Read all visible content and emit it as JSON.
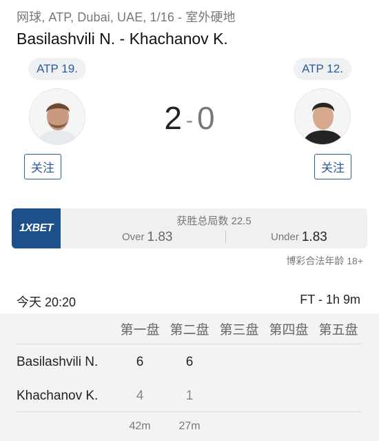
{
  "header": {
    "breadcrumb": "网球, ATP, Dubai, UAE, 1/16 - 室外硬地",
    "title": "Basilashvili N. - Khachanov K."
  },
  "home": {
    "rank": "ATP 19.",
    "follow_label": "关注"
  },
  "away": {
    "rank": "ATP 12.",
    "follow_label": "关注"
  },
  "score": {
    "home": "2",
    "separator": "-",
    "away": "0"
  },
  "odds": {
    "bookmaker": "1XBET",
    "market": "获胜总局数 22.5",
    "over_label": "Over",
    "over_value": "1.83",
    "under_label": "Under",
    "under_value": "1.83",
    "age_note": "博彩合法年龄 18+",
    "brand_color": "#1d4f8b"
  },
  "match": {
    "time": "今天 20:20",
    "status": "FT - 1h 9m"
  },
  "sets": {
    "headers": [
      "第一盘",
      "第二盘",
      "第三盘",
      "第四盘",
      "第五盘"
    ],
    "rows": [
      {
        "name": "Basilashvili N.",
        "scores": [
          "6",
          "6"
        ]
      },
      {
        "name": "Khachanov K.",
        "scores": [
          "4",
          "1"
        ]
      }
    ],
    "durations": [
      "42m",
      "27m"
    ]
  }
}
